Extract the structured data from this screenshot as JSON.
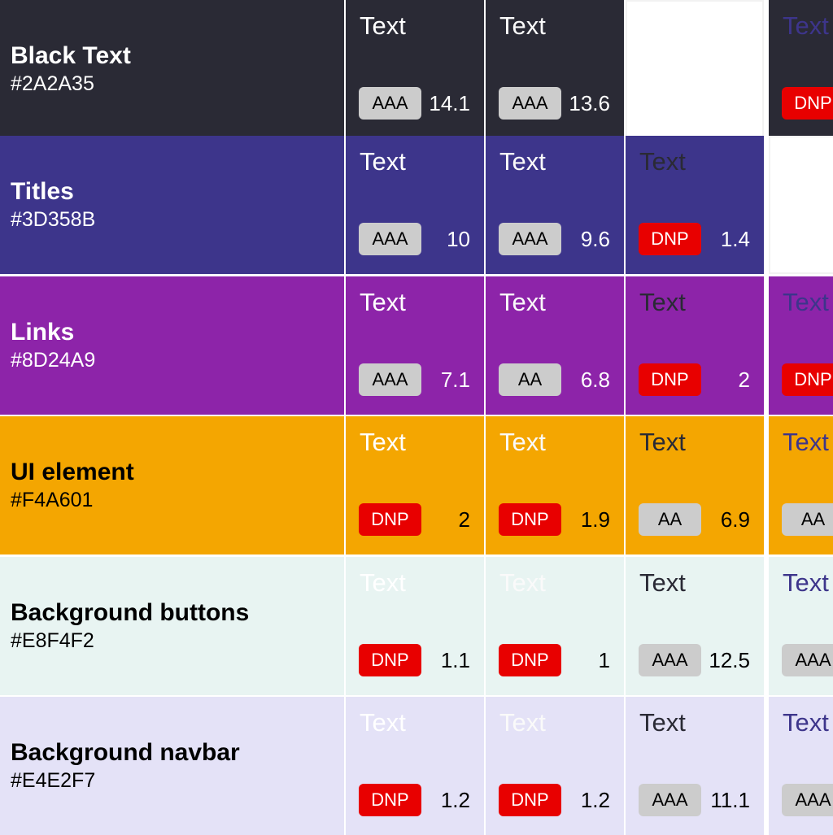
{
  "text_colors": [
    "#FFFFFF",
    "#FAFAFA",
    "#2A2A35",
    "#3D358B"
  ],
  "sample_text": "Text",
  "rows": [
    {
      "name": "Black Text",
      "hex": "#2A2A35",
      "bg": "#2A2A35",
      "label_color": "#FFFFFF",
      "ratio_color": "#FFFFFF",
      "cells": [
        {
          "rating": "AAA",
          "ratio": "14.1"
        },
        {
          "rating": "AAA",
          "ratio": "13.6"
        },
        {
          "empty": true
        },
        {
          "rating": "DNP",
          "ratio": ""
        }
      ]
    },
    {
      "name": "Titles",
      "hex": "#3D358B",
      "bg": "#3D358B",
      "label_color": "#FFFFFF",
      "ratio_color": "#FFFFFF",
      "cells": [
        {
          "rating": "AAA",
          "ratio": "10"
        },
        {
          "rating": "AAA",
          "ratio": "9.6"
        },
        {
          "rating": "DNP",
          "ratio": "1.4"
        },
        {
          "empty": true
        }
      ]
    },
    {
      "name": "Links",
      "hex": "#8D24A9",
      "bg": "#8D24A9",
      "label_color": "#FFFFFF",
      "ratio_color": "#FFFFFF",
      "cells": [
        {
          "rating": "AAA",
          "ratio": "7.1"
        },
        {
          "rating": "AA",
          "ratio": "6.8"
        },
        {
          "rating": "DNP",
          "ratio": "2"
        },
        {
          "rating": "DNP",
          "ratio": ""
        }
      ]
    },
    {
      "name": "UI element",
      "hex": "#F4A601",
      "bg": "#F4A601",
      "label_color": "#000000",
      "ratio_color": "#000000",
      "cells": [
        {
          "rating": "DNP",
          "ratio": "2"
        },
        {
          "rating": "DNP",
          "ratio": "1.9"
        },
        {
          "rating": "AA",
          "ratio": "6.9"
        },
        {
          "rating": "AA",
          "ratio": ""
        }
      ]
    },
    {
      "name": "Background buttons",
      "hex": "#E8F4F2",
      "bg": "#E8F4F2",
      "label_color": "#000000",
      "ratio_color": "#000000",
      "cells": [
        {
          "rating": "DNP",
          "ratio": "1.1"
        },
        {
          "rating": "DNP",
          "ratio": "1"
        },
        {
          "rating": "AAA",
          "ratio": "12.5"
        },
        {
          "rating": "AAA",
          "ratio": ""
        }
      ]
    },
    {
      "name": "Background navbar",
      "hex": "#E4E2F7",
      "bg": "#E4E2F7",
      "label_color": "#000000",
      "ratio_color": "#000000",
      "cells": [
        {
          "rating": "DNP",
          "ratio": "1.2"
        },
        {
          "rating": "DNP",
          "ratio": "1.2"
        },
        {
          "rating": "AAA",
          "ratio": "11.1"
        },
        {
          "rating": "AAA",
          "ratio": ""
        }
      ]
    }
  ]
}
